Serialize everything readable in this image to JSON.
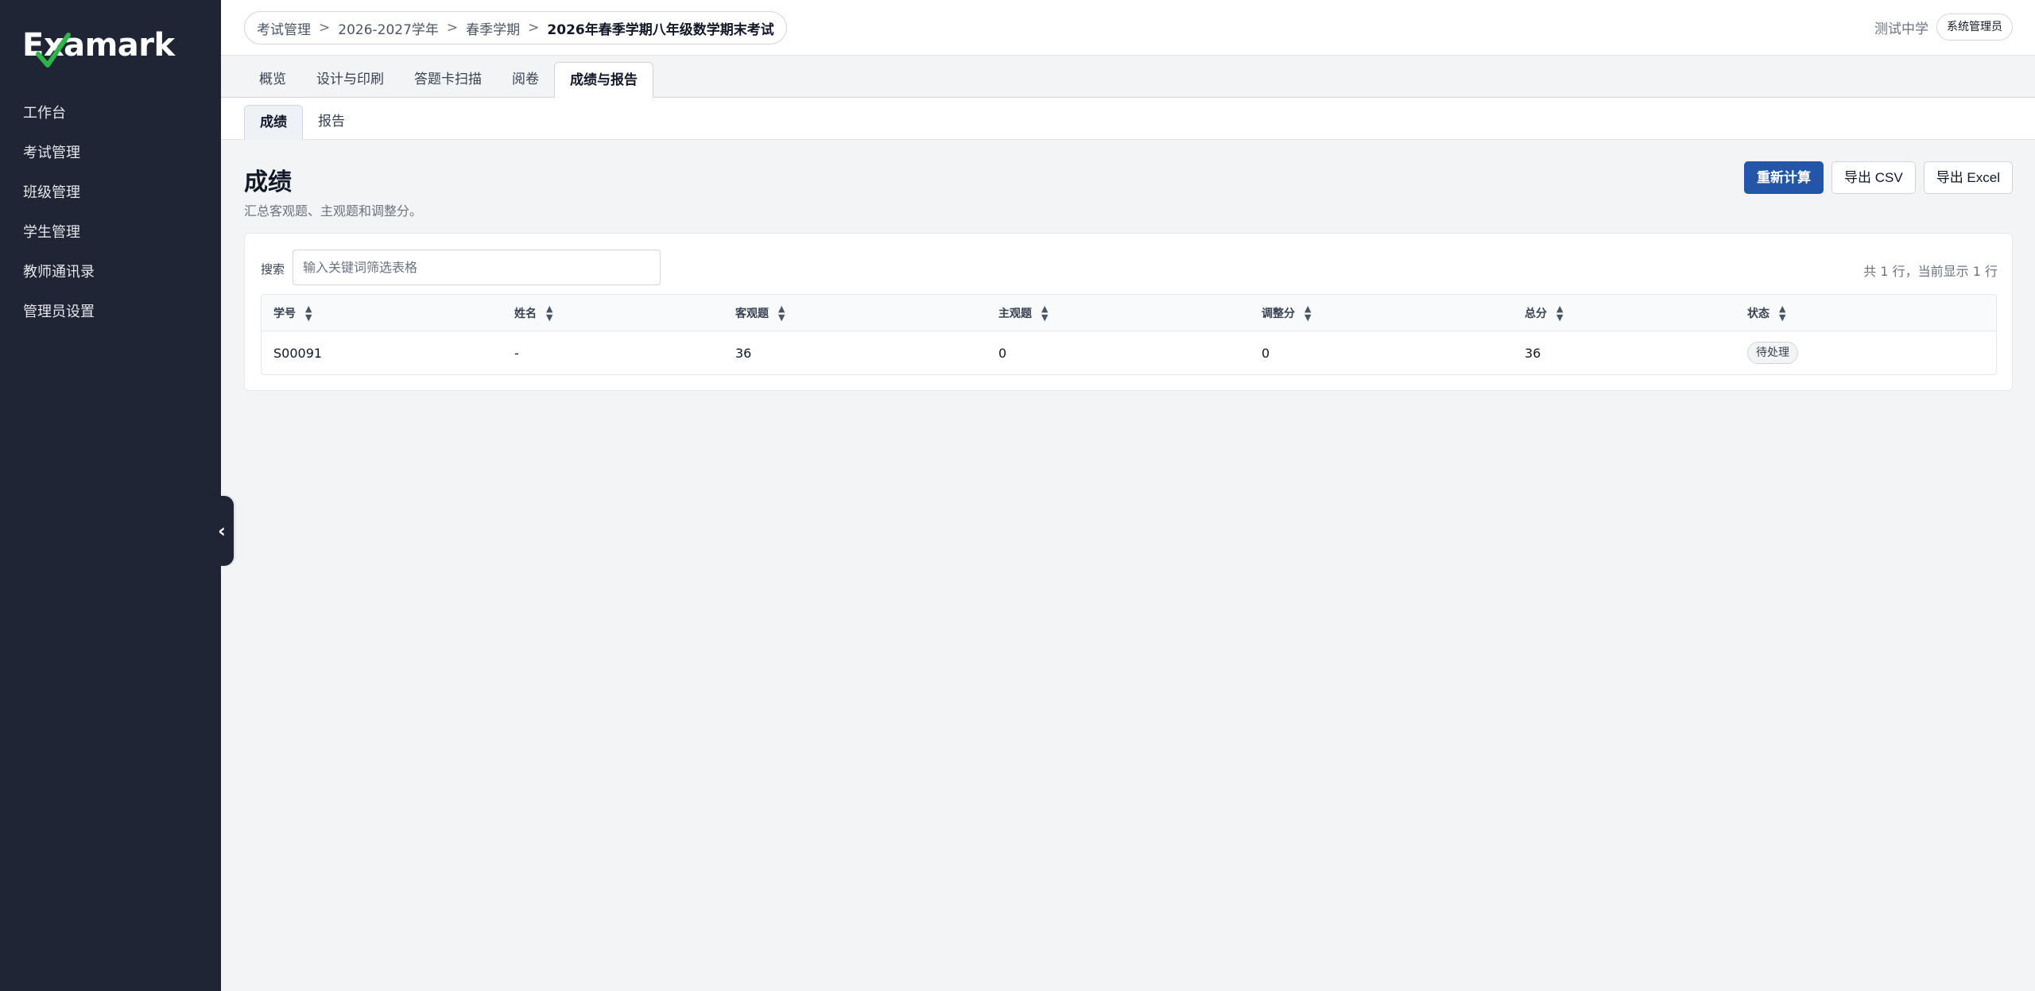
{
  "app": {
    "logo_text": "Examark"
  },
  "sidebar": {
    "items": [
      {
        "label": "工作台"
      },
      {
        "label": "考试管理"
      },
      {
        "label": "班级管理"
      },
      {
        "label": "学生管理"
      },
      {
        "label": "教师通讯录"
      },
      {
        "label": "管理员设置"
      }
    ],
    "collapse_glyph": "‹"
  },
  "header": {
    "breadcrumb": [
      "考试管理",
      "2026-2027学年",
      "春季学期",
      "2026年春季学期八年级数学期末考试"
    ],
    "separator": ">",
    "org_name": "测试中学",
    "role": "系统管理员"
  },
  "tabs": [
    {
      "label": "概览"
    },
    {
      "label": "设计与印刷"
    },
    {
      "label": "答题卡扫描"
    },
    {
      "label": "阅卷"
    },
    {
      "label": "成绩与报告"
    }
  ],
  "subtabs": [
    {
      "label": "成绩"
    },
    {
      "label": "报告"
    }
  ],
  "page": {
    "title": "成绩",
    "description": "汇总客观题、主观题和调整分。",
    "actions": {
      "recalculate": "重新计算",
      "export_csv": "导出 CSV",
      "export_excel": "导出 Excel"
    }
  },
  "table_panel": {
    "search_label": "搜索",
    "search_placeholder": "输入关键词筛选表格",
    "search_value": "",
    "row_count": "共 1 行，当前显示 1 行",
    "columns": [
      "学号",
      "姓名",
      "客观题",
      "主观题",
      "调整分",
      "总分",
      "状态"
    ],
    "rows": [
      {
        "student_id": "S00091",
        "name": "-",
        "objective": "36",
        "subjective": "0",
        "adjustment": "0",
        "total": "36",
        "status": "待处理"
      }
    ]
  },
  "colors": {
    "sidebar_bg": "#1f2535",
    "primary": "#2356a8",
    "page_bg": "#f3f4f6"
  }
}
